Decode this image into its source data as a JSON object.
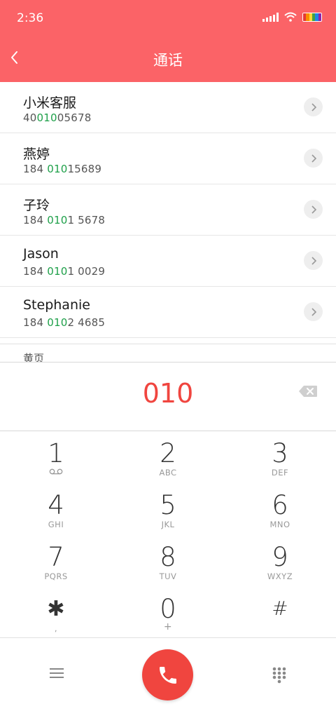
{
  "status_bar": {
    "time": "2:36"
  },
  "header": {
    "title": "通话"
  },
  "contacts": [
    {
      "name": "小米客服",
      "number_pre": "40",
      "number_hl": "010",
      "number_post": "05678"
    },
    {
      "name": "燕婷",
      "number_pre": "184 ",
      "number_hl": "010",
      "number_post": "15689"
    },
    {
      "name": "子玲",
      "number_pre": "184 ",
      "number_hl": "010",
      "number_post": "1 5678"
    },
    {
      "name": "Jason",
      "number_pre": "184 ",
      "number_hl": "010",
      "number_post": "1 0029"
    },
    {
      "name": "Stephanie",
      "number_pre": "184 ",
      "number_hl": "010",
      "number_post": "2 4685"
    }
  ],
  "section_label": "黄页",
  "dial_input": "010",
  "keys": [
    {
      "digit": "1",
      "letters": ""
    },
    {
      "digit": "2",
      "letters": "ABC"
    },
    {
      "digit": "3",
      "letters": "DEF"
    },
    {
      "digit": "4",
      "letters": "GHI"
    },
    {
      "digit": "5",
      "letters": "JKL"
    },
    {
      "digit": "6",
      "letters": "MNO"
    },
    {
      "digit": "7",
      "letters": "PQRS"
    },
    {
      "digit": "8",
      "letters": "TUV"
    },
    {
      "digit": "9",
      "letters": "WXYZ"
    },
    {
      "digit": "✱",
      "letters": ","
    },
    {
      "digit": "0",
      "letters": "+"
    },
    {
      "digit": "#",
      "letters": ""
    }
  ],
  "colors": {
    "header": "#fb6367",
    "accent": "#f0453f",
    "highlight": "#1fa04a"
  },
  "icons": {
    "back": "chevron-left-icon",
    "voicemail": "voicemail-icon",
    "backspace": "backspace-icon",
    "menu": "menu-icon",
    "call": "phone-icon",
    "dialpad": "dialpad-icon"
  }
}
